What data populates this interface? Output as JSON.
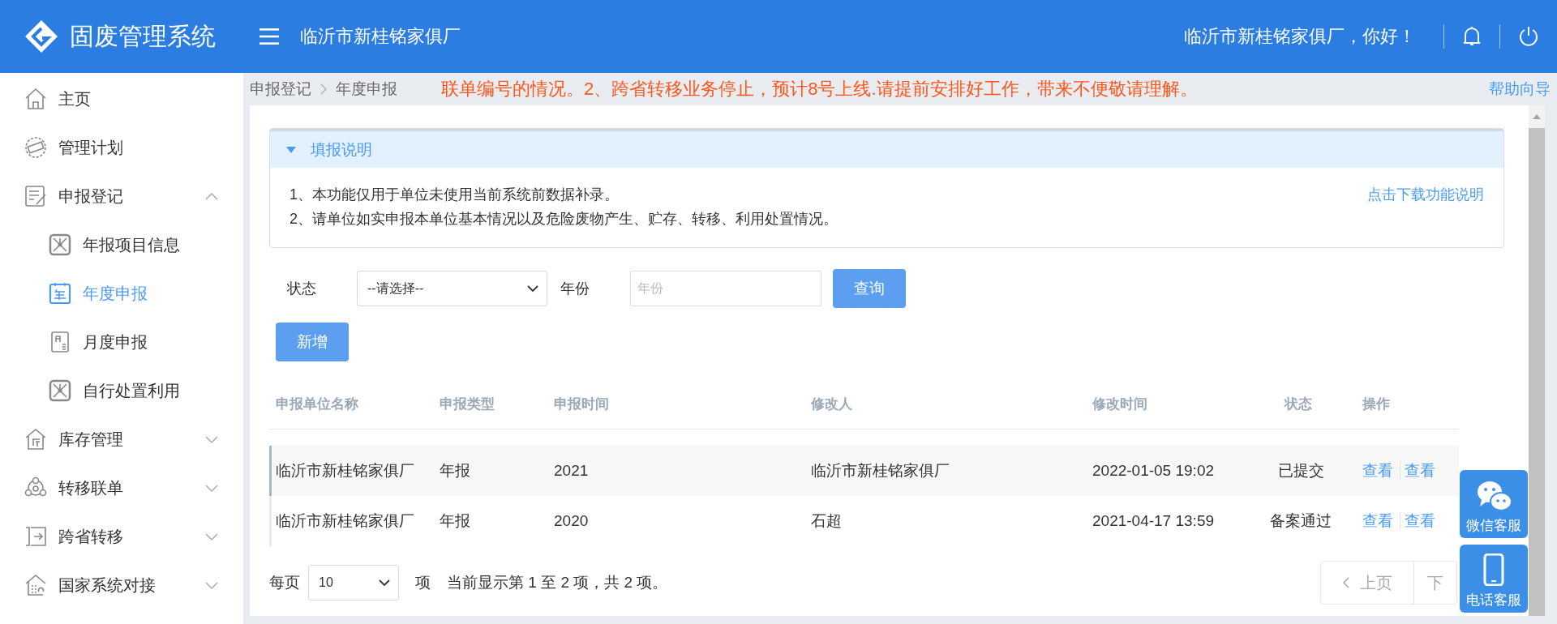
{
  "header": {
    "title": "固废管理系统",
    "company": "临沂市新桂铭家俱厂",
    "greeting": "临沂市新桂铭家俱厂，你好！"
  },
  "sidebar": {
    "items": [
      {
        "label": "主页",
        "selected": false
      },
      {
        "label": "管理计划",
        "selected": false
      },
      {
        "label": "申报登记",
        "selected": false,
        "expanded": true,
        "children": [
          {
            "label": "年报项目信息",
            "selected": false
          },
          {
            "label": "年度申报",
            "selected": true
          },
          {
            "label": "月度申报",
            "selected": false
          },
          {
            "label": "自行处置利用",
            "selected": false
          }
        ]
      },
      {
        "label": "库存管理",
        "selected": false,
        "expanded": false
      },
      {
        "label": "转移联单",
        "selected": false,
        "expanded": false
      },
      {
        "label": "跨省转移",
        "selected": false,
        "expanded": false
      },
      {
        "label": "国家系统对接",
        "selected": false,
        "expanded": false
      }
    ]
  },
  "breadcrumb": [
    "申报登记",
    "年度申报"
  ],
  "notice": "联单编号的情况。2、跨省转移业务停止，预计8号上线.请提前安排好工作，带来不便敬请理解。",
  "help_link": "帮助向导",
  "instructions": {
    "title": "填报说明",
    "expanded": true,
    "lines": [
      "1、本功能仅用于单位未使用当前系统前数据补录。",
      "2、请单位如实申报本单位基本情况以及危险废物产生、贮存、转移、利用处置情况。"
    ],
    "download_link": "点击下载功能说明"
  },
  "filters": {
    "status_label": "状态",
    "status_value": "--请选择--",
    "year_label": "年份",
    "year_placeholder": "年份",
    "query_button": "查询",
    "add_button": "新增"
  },
  "table": {
    "columns": [
      "申报单位名称",
      "申报类型",
      "申报时间",
      "修改人",
      "修改时间",
      "状态",
      "操作"
    ],
    "rows": [
      {
        "selected": true,
        "cells": [
          "临沂市新桂铭家俱厂",
          "年报",
          "2021",
          "临沂市新桂铭家俱厂",
          "2022-01-05 19:02",
          "已提交"
        ],
        "actions": [
          "查看",
          "查看"
        ]
      },
      {
        "selected": false,
        "cells": [
          "临沂市新桂铭家俱厂",
          "年报",
          "2020",
          "石超",
          "2021-04-17 13:59",
          "备案通过"
        ],
        "actions": [
          "查看",
          "查看"
        ]
      }
    ]
  },
  "pagination": {
    "per_page_label": "每页",
    "per_page": "10",
    "unit": "项",
    "summary": "当前显示第 1 至 2 项，共 2 项。",
    "prev": "上页",
    "next": "下"
  },
  "float_widgets": [
    "微信客服",
    "电话客服"
  ]
}
